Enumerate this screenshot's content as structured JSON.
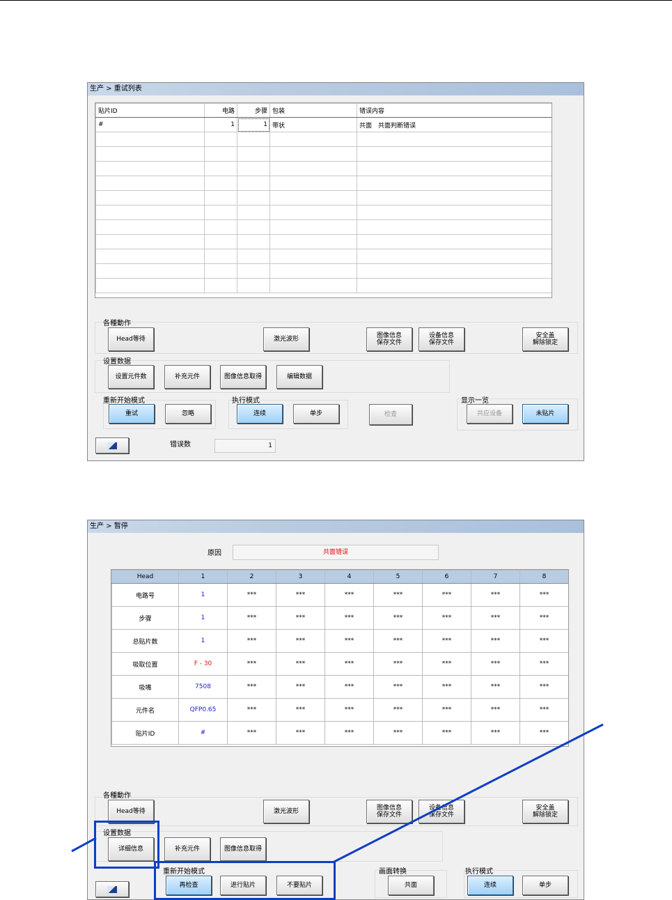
{
  "retry_window": {
    "title": "生产 > 重试列表",
    "table": {
      "headers": [
        "贴片ID",
        "电路",
        "步骤",
        "包装",
        "错误内容"
      ],
      "rows": [
        [
          "#",
          "1",
          "1",
          "带状",
          "共面　共面判断错误"
        ]
      ]
    },
    "actions": {
      "group_label": "各種動作",
      "head_wait": "Head等待",
      "laser": "激光波形",
      "image_save": "图像信息\n保存文件",
      "device_save": "设备信息\n保存文件",
      "safety": "安全盖\n解除锁定"
    },
    "settings": {
      "group_label": "设置数据",
      "set_parts": "设置元件数",
      "supply": "补充元件",
      "image_get": "图像信息取得",
      "edit": "编辑数据"
    },
    "restart": {
      "group_label": "重新开始模式",
      "retry": "重试",
      "skip": "忽略"
    },
    "exec": {
      "group_label": "执行模式",
      "continuous": "连续",
      "single": "单步"
    },
    "check": "检查",
    "display": {
      "group_label": "显示一览",
      "shared": "共应设备",
      "unplaced": "未贴片"
    },
    "error_count_label": "错误数",
    "error_count": "1"
  },
  "pause_window": {
    "title": "生产 > 暂停",
    "reason_label": "原因",
    "reason_value": "共面错误",
    "table": {
      "headers": [
        "Head",
        "1",
        "2",
        "3",
        "4",
        "5",
        "6",
        "7",
        "8"
      ],
      "rows": [
        {
          "label": "电路号",
          "h1": "1"
        },
        {
          "label": "步骤",
          "h1": "1"
        },
        {
          "label": "总贴片数",
          "h1": "1"
        },
        {
          "label": "吸取位置",
          "h1": "F - 30"
        },
        {
          "label": "吸嘴",
          "h1": "7508"
        },
        {
          "label": "元件名",
          "h1": "QFP0.65"
        },
        {
          "label": "贴片ID",
          "h1": "#"
        }
      ],
      "empty": "***"
    },
    "actions": {
      "group_label": "各種動作",
      "head_wait": "Head等待",
      "laser": "激光波形",
      "image_save": "图像信息\n保存文件",
      "device_save": "设备信息\n保存文件",
      "safety": "安全盖\n解除锁定"
    },
    "settings": {
      "group_label": "设置数据",
      "detail": "详细信息",
      "supply": "补充元件",
      "image_get": "图像信息取得"
    },
    "restart": {
      "group_label": "重新开始模式",
      "recheck": "再检查",
      "place": "进行贴片",
      "no_place": "不要贴片"
    },
    "screen": {
      "group_label": "画面转换",
      "coplanar": "共面"
    },
    "exec": {
      "group_label": "执行模式",
      "continuous": "连续",
      "single": "单步"
    }
  },
  "colors": {
    "highlight": "#0c3fc2",
    "reason": "#d11111",
    "head1_value": "#1a1ad8"
  }
}
